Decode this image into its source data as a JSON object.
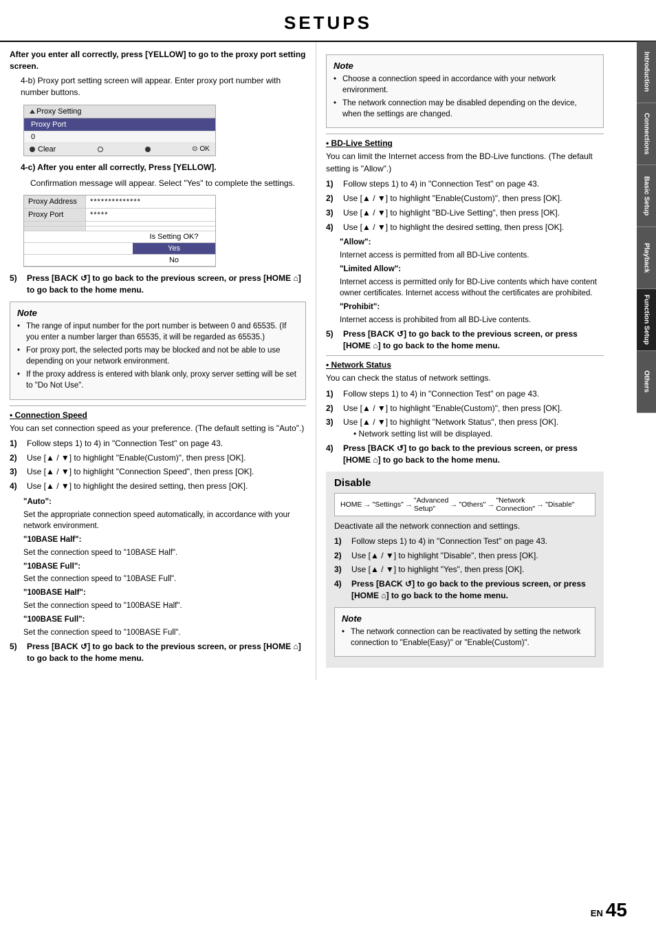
{
  "page": {
    "title": "SETUPS",
    "page_number": "45",
    "page_en": "EN"
  },
  "side_tabs": [
    {
      "label": "Introduction",
      "active": false
    },
    {
      "label": "Connections",
      "active": false
    },
    {
      "label": "Basic Setup",
      "active": false
    },
    {
      "label": "Playback",
      "active": false
    },
    {
      "label": "Function Setup",
      "active": true
    },
    {
      "label": "Others",
      "active": false
    }
  ],
  "left_col": {
    "intro_bold": "After you enter all correctly, press [YELLOW] to go to the proxy port setting screen.",
    "sub_4b": "4-b)  Proxy port setting screen will appear. Enter proxy port number with number buttons.",
    "proxy_screen": {
      "title": "Proxy Setting",
      "field_label": "Proxy Port",
      "field_value": "0",
      "clear_label": "Clear",
      "ok_label": "OK"
    },
    "sub_4c": "4-c)  After you enter all correctly, Press [YELLOW].",
    "sub_4c_bullet": "Confirmation message will appear. Select \"Yes\" to complete the settings.",
    "address_screen": {
      "rows": [
        {
          "label": "Proxy Address",
          "value": "**************"
        },
        {
          "label": "Proxy Port",
          "value": "*****"
        },
        {
          "label": "",
          "value": ""
        },
        {
          "label": "",
          "value": ""
        },
        {
          "label": "",
          "value": ""
        },
        {
          "label": "",
          "value": ""
        }
      ],
      "popup": {
        "question": "Is Setting OK?",
        "yes": "Yes",
        "no": "No"
      }
    },
    "step5": {
      "num": "5)",
      "text": "Press [BACK ↺] to go back to the previous screen, or press [HOME ⌂] to go back to the home menu."
    },
    "note": {
      "title": "Note",
      "items": [
        "The range of input number for the port number is between 0 and 65535.  (If you enter a number larger than 65535, it will be regarded as 65535.)",
        "For proxy port, the selected ports may be blocked and not be able to use depending on  your network environment.",
        "If the proxy address is entered with blank only, proxy server setting will be set to \"Do Not Use\"."
      ]
    },
    "connection_speed": {
      "heading": "Connection Speed",
      "intro": "You can set connection speed as your preference. (The default setting is \"Auto\".)",
      "steps": [
        {
          "num": "1)",
          "text": "Follow steps 1) to 4) in \"Connection Test\" on page 43."
        },
        {
          "num": "2)",
          "text": "Use [▲ / ▼] to highlight \"Enable(Custom)\", then press [OK]."
        },
        {
          "num": "3)",
          "text": "Use [▲ / ▼] to highlight \"Connection Speed\", then press [OK]."
        },
        {
          "num": "4)",
          "text": "Use [▲ / ▼] to highlight the desired setting, then press [OK]."
        }
      ],
      "settings": [
        {
          "label": "\"Auto\":",
          "desc": "Set the appropriate connection speed automatically, in accordance with your network environment."
        },
        {
          "label": "\"10BASE Half\":",
          "desc": "Set the connection speed to \"10BASE Half\"."
        },
        {
          "label": "\"10BASE Full\":",
          "desc": "Set the connection speed to \"10BASE Full\"."
        },
        {
          "label": "\"100BASE Half\":",
          "desc": "Set the connection speed to \"100BASE Half\"."
        },
        {
          "label": "\"100BASE Full\":",
          "desc": "Set the connection speed to \"100BASE Full\"."
        }
      ],
      "step5": {
        "num": "5)",
        "text": "Press [BACK ↺] to go back to the previous screen, or press [HOME ⌂] to go back to the home menu."
      }
    }
  },
  "right_col": {
    "right_note": {
      "title": "Note",
      "items": [
        "Choose a connection speed in accordance with your network environment.",
        "The network connection may be disabled depending on the device, when the settings are changed."
      ]
    },
    "bd_live": {
      "heading": "BD-Live Setting",
      "intro": "You can limit the Internet access from the BD-Live functions. (The default setting is \"Allow\".)",
      "steps": [
        {
          "num": "1)",
          "text": "Follow steps 1) to 4) in \"Connection Test\" on page 43."
        },
        {
          "num": "2)",
          "text": "Use [▲ / ▼] to highlight \"Enable(Custom)\", then press [OK]."
        },
        {
          "num": "3)",
          "text": "Use [▲ / ▼] to highlight \"BD-Live Setting\", then press [OK]."
        },
        {
          "num": "4)",
          "text": "Use [▲ / ▼] to highlight the desired setting, then press [OK]."
        }
      ],
      "settings": [
        {
          "label": "\"Allow\":",
          "desc": "Internet access is permitted from all BD-Live contents."
        },
        {
          "label": "\"Limited Allow\":",
          "desc": "Internet access is permitted only for BD-Live contents which have content owner certificates. Internet access without the certificates are prohibited."
        },
        {
          "label": "\"Prohibit\":",
          "desc": "Internet access is prohibited from all BD-Live contents."
        }
      ],
      "step5": {
        "num": "5)",
        "text": "Press [BACK ↺] to go back to the previous screen, or press [HOME ⌂] to go back to the home menu."
      }
    },
    "network_status": {
      "heading": "Network Status",
      "intro": "You can check the status of network settings.",
      "steps": [
        {
          "num": "1)",
          "text": "Follow steps 1) to 4) in \"Connection Test\" on page 43."
        },
        {
          "num": "2)",
          "text": "Use [▲ / ▼] to highlight \"Enable(Custom)\", then press [OK]."
        },
        {
          "num": "3)",
          "text": "Use [▲ / ▼] to highlight \"Network Status\", then press [OK].",
          "sub": "Network setting list will be displayed."
        },
        {
          "num": "4)",
          "text": "Press [BACK ↺] to go back to the previous screen, or press [HOME ⌂] to go back to the home menu."
        }
      ]
    },
    "disable": {
      "heading": "Disable",
      "nav": [
        "HOME",
        "→ \"Settings\"",
        "→ \"Advanced Setup\"",
        "→ \"Others\"",
        "→ \"Network Connection\"",
        "→ \"Disable\""
      ],
      "intro": "Deactivate all the network connection and settings.",
      "steps": [
        {
          "num": "1)",
          "text": "Follow steps 1) to 4) in \"Connection Test\" on page 43."
        },
        {
          "num": "2)",
          "text": "Use [▲ / ▼] to highlight \"Disable\", then press [OK]."
        },
        {
          "num": "3)",
          "text": "Use [▲ / ▼] to highlight \"Yes\", then press [OK]."
        },
        {
          "num": "4)",
          "text": "Press [BACK ↺] to go back to the previous screen, or press [HOME ⌂] to go back to the home menu."
        }
      ],
      "note": {
        "title": "Note",
        "items": [
          "The network connection can be reactivated by setting the network connection to \"Enable(Easy)\" or \"Enable(Custom)\"."
        ]
      }
    }
  }
}
